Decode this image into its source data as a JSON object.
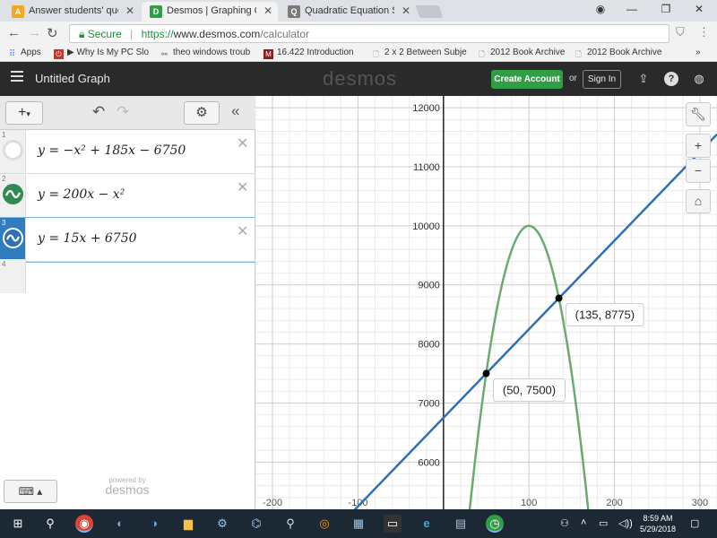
{
  "browser": {
    "tabs": [
      {
        "label": "Answer students' questio",
        "favicon": "answer-favicon"
      },
      {
        "label": "Desmos | Graphing Calcu",
        "favicon": "desmos-favicon",
        "active": true
      },
      {
        "label": "Quadratic Equation Solve",
        "favicon": "calculator-favicon"
      }
    ],
    "address": {
      "secure_label": "Secure",
      "url_protocol": "https://",
      "url_host": "www.desmos.com",
      "url_path": "/calculator"
    },
    "bookmarks": [
      {
        "label": "Apps",
        "icon": "apps-grid-icon"
      },
      {
        "label": "▶ Why Is My PC Slo",
        "icon": "power-icon"
      },
      {
        "label": "theo windows troub",
        "icon": "link-icon"
      },
      {
        "label": "16.422 Introduction",
        "icon": "mit-icon"
      },
      {
        "label": "2 x 2 Between Subje",
        "icon": "page-icon"
      },
      {
        "label": "2012 Book Archive",
        "icon": "page-icon"
      },
      {
        "label": "2012 Book Archive",
        "icon": "page-icon"
      }
    ],
    "bookmarks_overflow": "»"
  },
  "desmos": {
    "graph_title": "Untitled Graph",
    "brand": "desmos",
    "create_account": "Create Account",
    "or_text": "or",
    "sign_in": "Sign In",
    "powered_by": "powered by",
    "powered_brand": "desmos",
    "expressions": [
      {
        "number": "1",
        "latex": "y = −x² + 185x − 6750",
        "color": "#c74440",
        "hidden": true
      },
      {
        "number": "2",
        "latex": "y = 200x − x²",
        "color": "#2d8c4f",
        "hidden": false
      },
      {
        "number": "3",
        "latex": "y = 15x + 6750",
        "color": "#2d70b3",
        "hidden": false,
        "selected": true
      }
    ],
    "empty_row_number": "4"
  },
  "chart_data": {
    "type": "line",
    "xlim": [
      -220,
      320
    ],
    "ylim": [
      5200,
      12200
    ],
    "x_ticks": [
      -200,
      -100,
      100,
      200,
      300
    ],
    "y_ticks": [
      6000,
      7000,
      8000,
      9000,
      10000,
      11000,
      12000
    ],
    "grid": true,
    "series": [
      {
        "expression": "y = 200x − x²",
        "color": "#6aab6f",
        "coeffs": {
          "a": -1,
          "b": 200,
          "c": 0
        }
      },
      {
        "expression": "y = 15x + 6750",
        "color": "#2d70b3",
        "coeffs": {
          "a": 0,
          "b": 15,
          "c": 6750
        }
      }
    ],
    "points": [
      {
        "x": 135,
        "y": 8775,
        "label": "(135, 8775)"
      },
      {
        "x": 50,
        "y": 7500,
        "label": "(50, 7500)"
      }
    ]
  },
  "taskbar": {
    "time": "8:59 AM",
    "date": "5/29/2018",
    "apps": [
      "windows-start-icon",
      "search-icon",
      "chrome-icon",
      "app-icon",
      "edge-icon",
      "file-explorer-icon",
      "settings-icon",
      "magnifier-icon",
      "app-icon",
      "app-icon",
      "terminal-icon",
      "edge-icon",
      "calendar-icon",
      "desmos-icon"
    ]
  }
}
